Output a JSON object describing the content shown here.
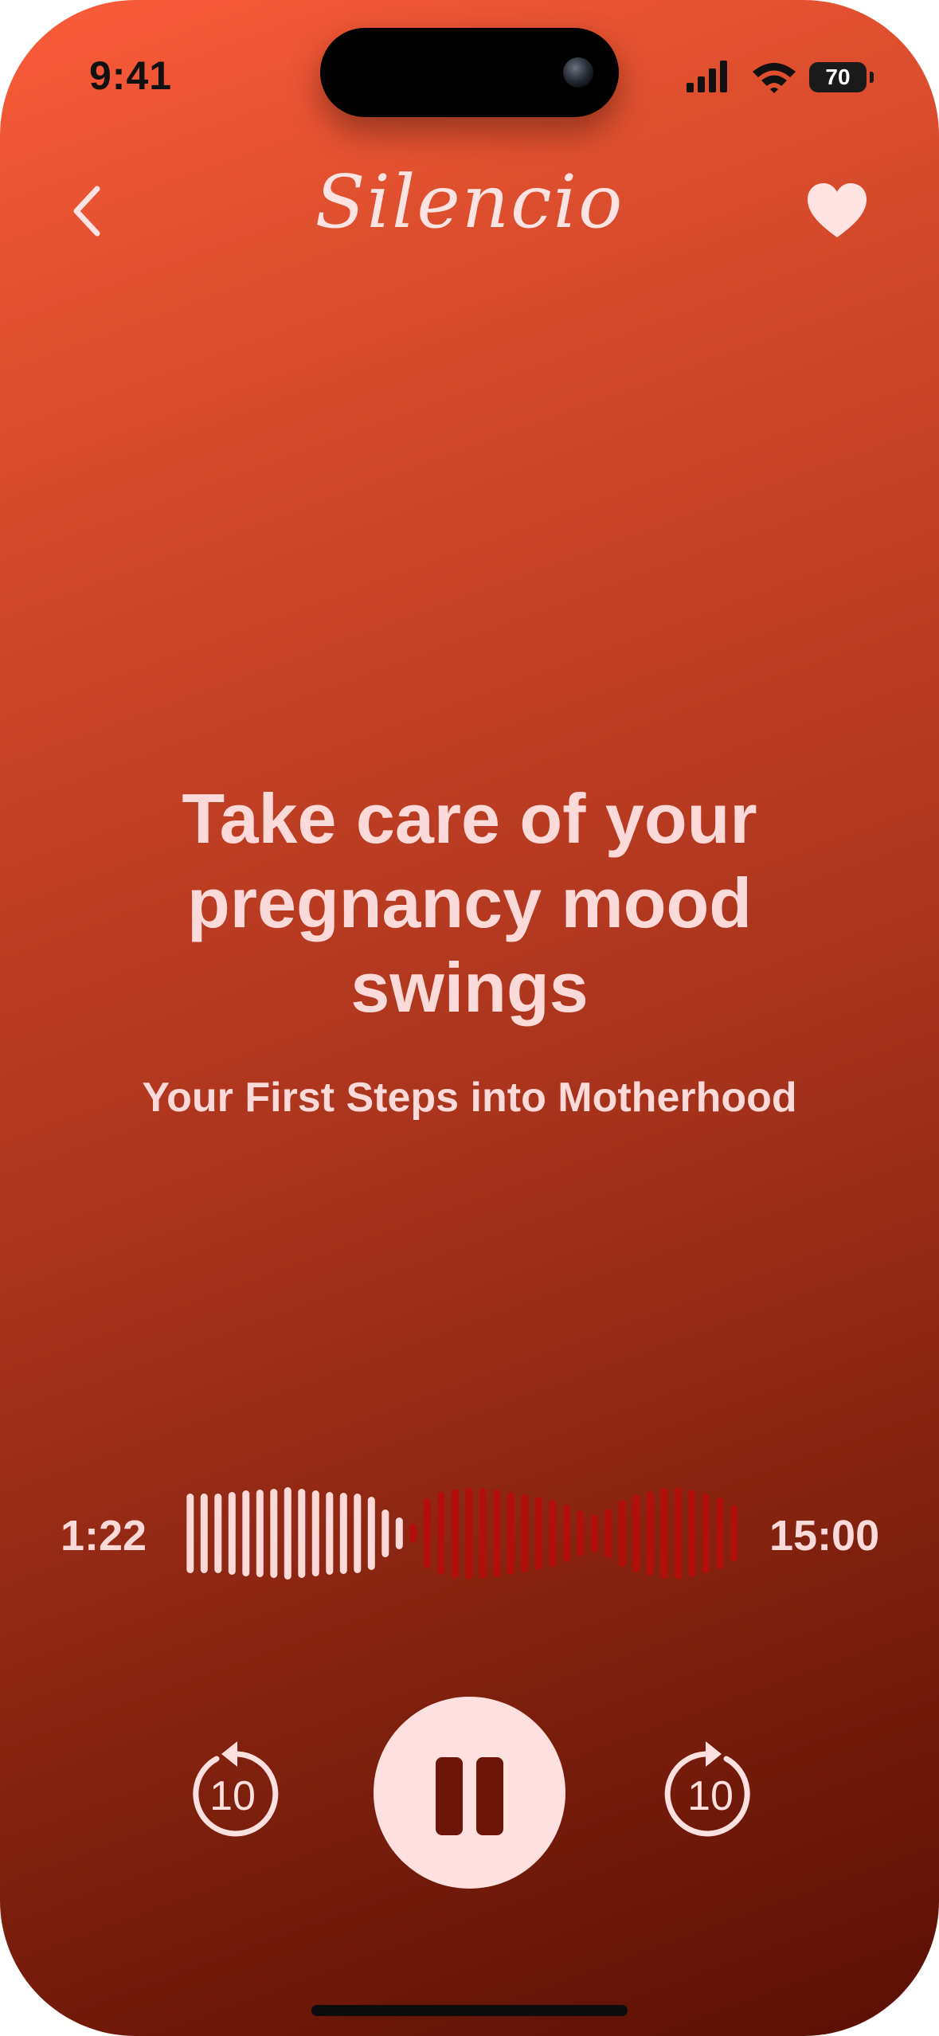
{
  "status_bar": {
    "time": "9:41",
    "battery": "70",
    "icons": [
      "signal-icon",
      "wifi-icon",
      "battery-icon"
    ]
  },
  "header": {
    "app_title": "Silencio",
    "back_icon": "chevron-left-icon",
    "favorite_icon": "heart-icon"
  },
  "content": {
    "title": "Take care of your pregnancy mood swings",
    "subtitle": "Your First Steps into Motherhood"
  },
  "player": {
    "elapsed": "1:22",
    "duration": "15:00",
    "progress_fraction": 0.41,
    "rewind_label": "10",
    "forward_label": "10",
    "state": "playing",
    "played_color": "#fdd9d8",
    "unplayed_color": "#b20f0a"
  },
  "colors": {
    "gradient_top": "#fb5b3a",
    "gradient_bottom": "#5a0f04",
    "text": "#fddada"
  }
}
